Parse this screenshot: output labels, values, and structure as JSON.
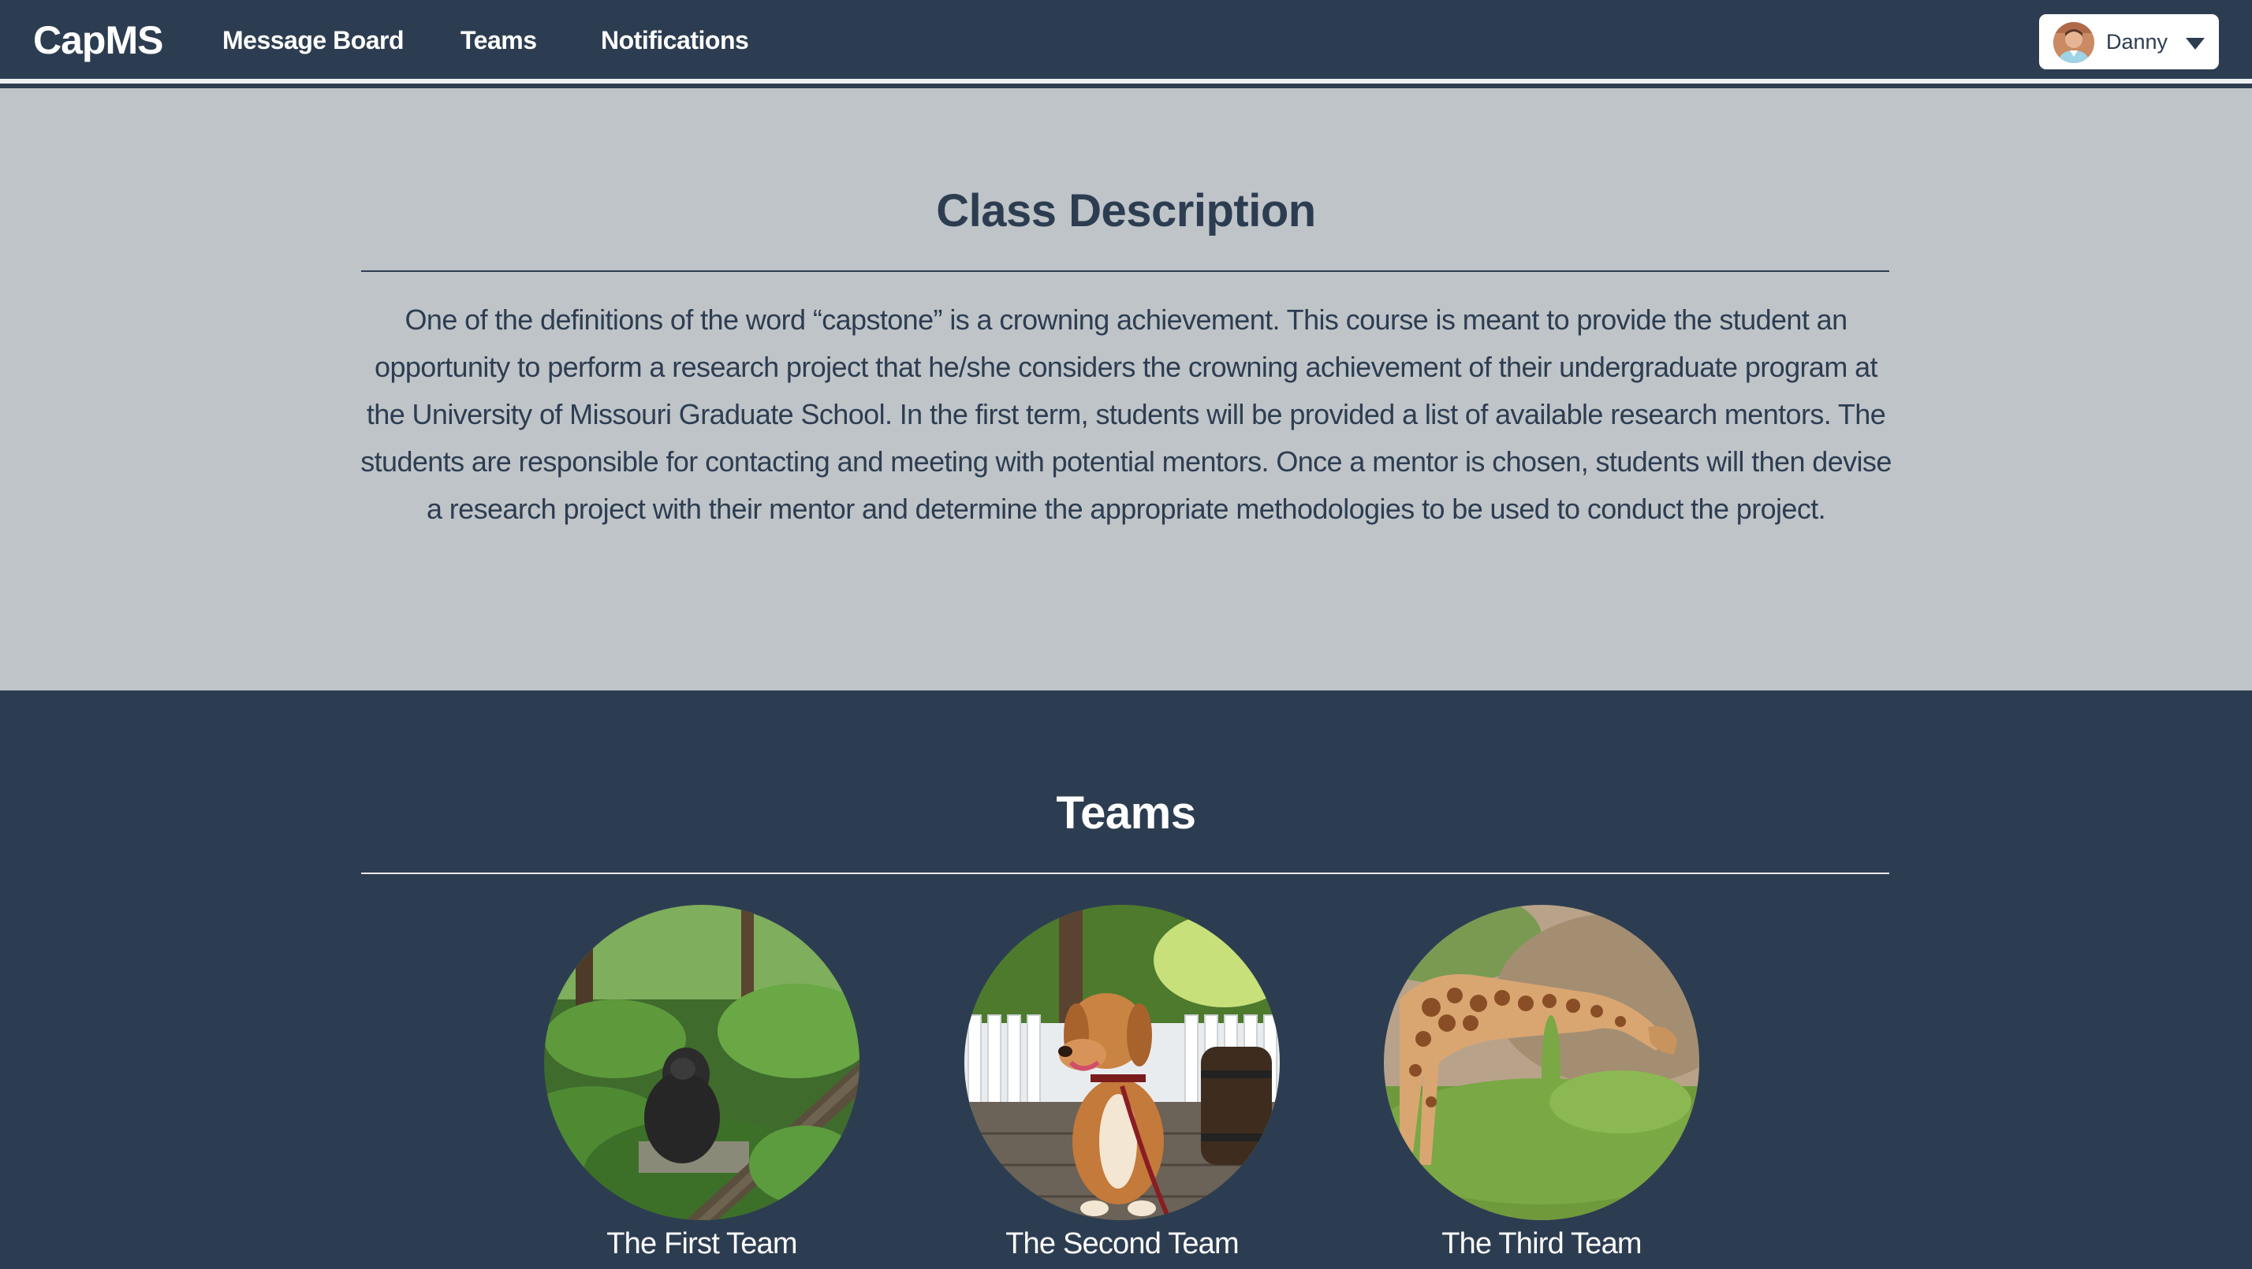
{
  "navbar": {
    "brand": "CapMS",
    "links": [
      "Message Board",
      "Teams",
      "Notifications"
    ],
    "user": {
      "name": "Danny",
      "avatar_icon": "user-avatar",
      "menu_icon": "caret-down-icon"
    }
  },
  "description": {
    "title": "Class Description",
    "text": "One of the definitions of the word “capstone” is a crowning achievement. This course is meant to provide the student an opportunity to perform a research project that he/she considers the crowning achievement of their undergraduate program at the University of Missouri Graduate School. In the first term, students will be provided a list of available research mentors. The students are responsible for contacting and meeting with potential mentors. Once a mentor is chosen, students will then devise a research project with their mentor and determine the appropriate methodologies to be used to conduct the project."
  },
  "teams": {
    "title": "Teams",
    "items": [
      {
        "name": "The First Team",
        "image": "gorilla-photo"
      },
      {
        "name": "The Second Team",
        "image": "dog-photo"
      },
      {
        "name": "The Third Team",
        "image": "giraffe-photo"
      }
    ]
  },
  "colors": {
    "navy": "#2d3d51",
    "light_gray": "#bfc4c8",
    "white": "#ffffff"
  }
}
